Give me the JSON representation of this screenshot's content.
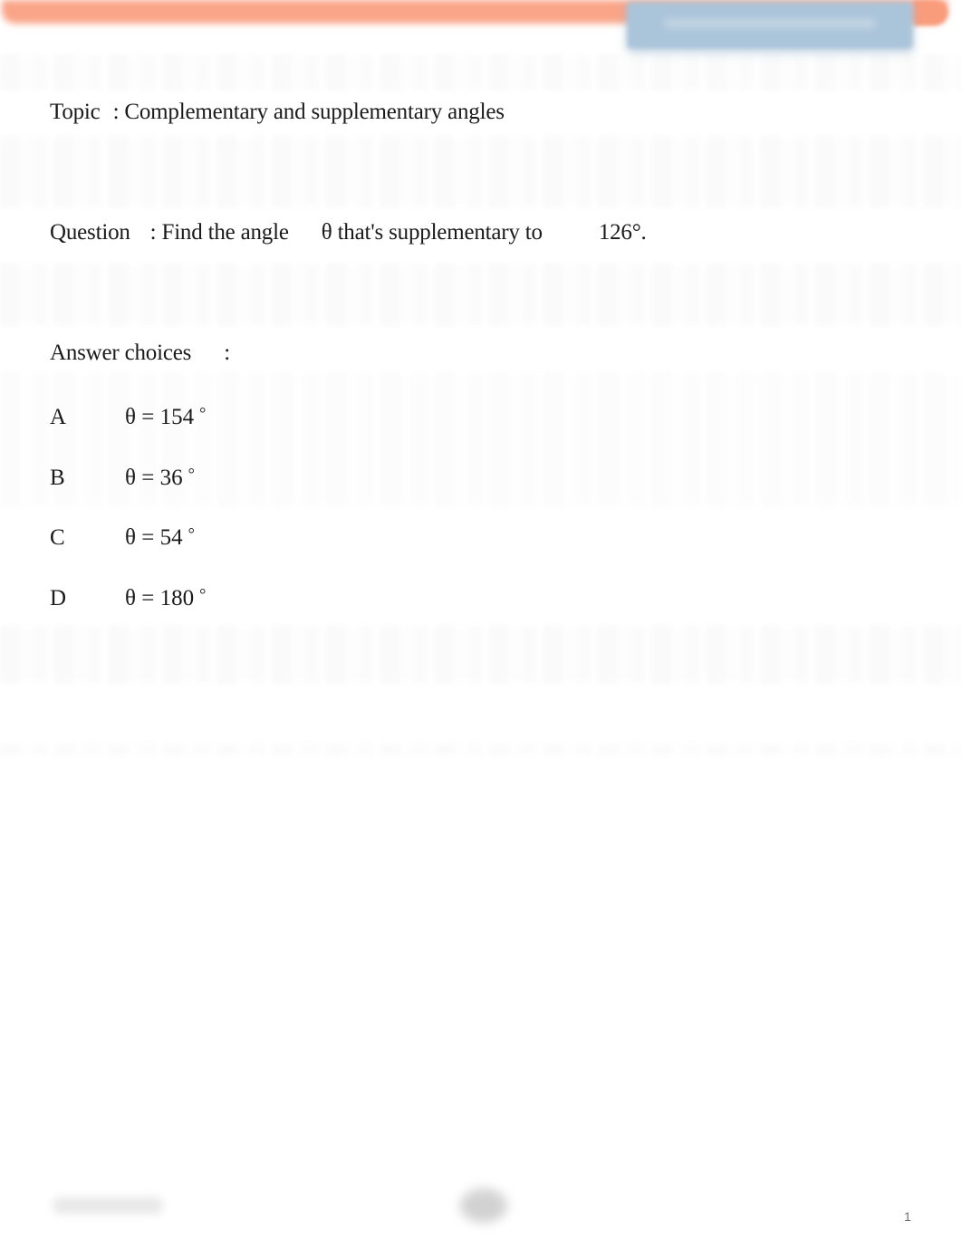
{
  "header": {
    "banner_color": "#f9a487",
    "action_button": {
      "label": "",
      "color": "#aac4da"
    }
  },
  "topic": {
    "label": "Topic",
    "separator": ":",
    "value": "Complementary and supplementary angles"
  },
  "question": {
    "label": "Question",
    "separator": ":",
    "text_before": "Find the angle",
    "variable": "θ",
    "text_after": "that's supplementary to",
    "value": "126°."
  },
  "answers": {
    "label": "Answer choices",
    "separator": ":",
    "choices": [
      {
        "letter": "A",
        "variable": "θ",
        "equals": "=",
        "value": "154",
        "unit": "°"
      },
      {
        "letter": "B",
        "variable": "θ",
        "equals": "=",
        "value": "36",
        "unit": "°"
      },
      {
        "letter": "C",
        "variable": "θ",
        "equals": "=",
        "value": "54",
        "unit": "°"
      },
      {
        "letter": "D",
        "variable": "θ",
        "equals": "=",
        "value": "180",
        "unit": "°"
      }
    ]
  },
  "footer": {
    "page_number": "1"
  }
}
